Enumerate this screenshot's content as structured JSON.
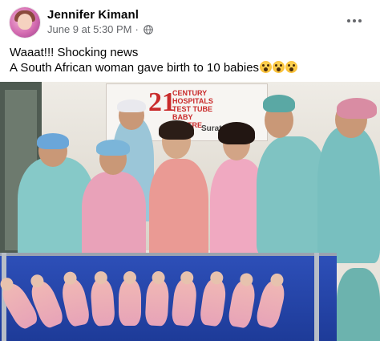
{
  "post": {
    "author": "Jennifer Kimanl",
    "date": "June 9 at 5:30 PM",
    "separator": "·",
    "privacy_icon": "globe-icon",
    "more_icon": "more-horizontal-icon",
    "text_line1": "Waaat!!! Shocking news",
    "text_line2": "A South African woman gave birth to 10 babies",
    "emoji": [
      "astonished-face-emoji",
      "astonished-face-emoji",
      "astonished-face-emoji"
    ]
  },
  "photo": {
    "banner_number": "21",
    "banner_text": "Century Hospitals Test Tube Baby Centre",
    "banner_city": "Surat"
  },
  "colors": {
    "scrubs_teal": "#7fc3c2",
    "scrubs_pink": "#e79aa8",
    "bed_blue": "#2d4fb8",
    "meta_gray": "#65676b"
  }
}
